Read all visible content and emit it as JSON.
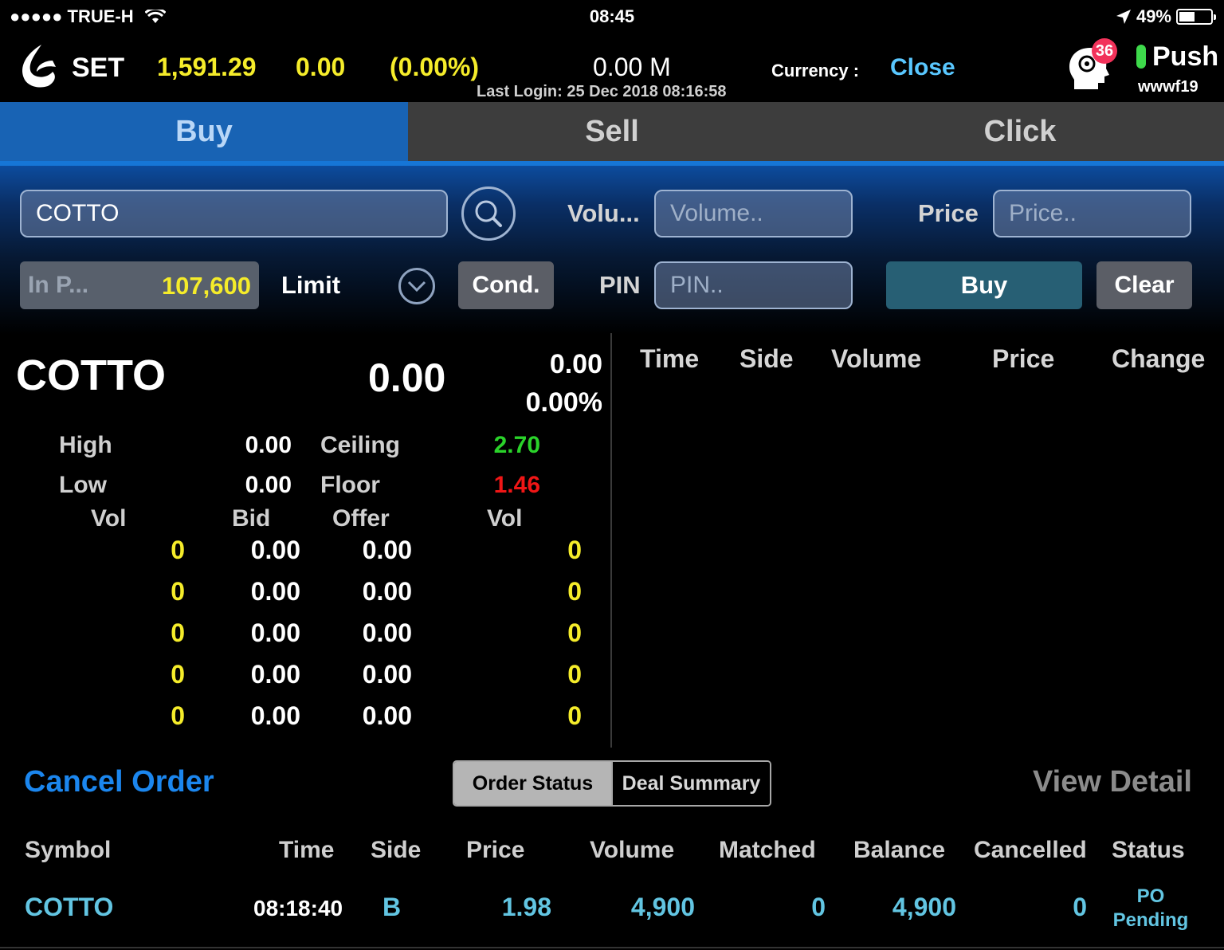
{
  "status_bar": {
    "carrier": "●●●●● TRUE-H",
    "time": "08:45",
    "battery": "49%",
    "battery_level": 0.49
  },
  "header": {
    "market": "SET",
    "index_value": "1,591.29",
    "index_change": "0.00",
    "index_change_pct": "(0.00%)",
    "value_traded": "0.00 M",
    "last_login": "Last Login: 25 Dec 2018 08:16:58",
    "currency_label": "Currency :",
    "currency_value": "Close",
    "notification_count": "36",
    "push_label": "Push",
    "username": "wwwf19"
  },
  "tabs": [
    {
      "label": "Buy",
      "active": true
    },
    {
      "label": "Sell",
      "active": false
    },
    {
      "label": "Click",
      "active": false
    }
  ],
  "order_form": {
    "symbol_value": "COTTO",
    "volume_label": "Volu...",
    "volume_placeholder": "Volume..",
    "price_label": "Price",
    "price_placeholder": "Price..",
    "inport_label": "In P...",
    "inport_value": "107,600",
    "order_type": "Limit",
    "cond_label": "Cond.",
    "pin_label": "PIN",
    "pin_placeholder": "PIN..",
    "buy_label": "Buy",
    "clear_label": "Clear"
  },
  "quote": {
    "symbol": "COTTO",
    "last": "0.00",
    "change": "0.00",
    "change_pct": "0.00%",
    "high_label": "High",
    "high": "0.00",
    "low_label": "Low",
    "low": "0.00",
    "ceiling_label": "Ceiling",
    "ceiling": "2.70",
    "floor_label": "Floor",
    "floor": "1.46",
    "depth_headers": [
      "Vol",
      "Bid",
      "Offer",
      "Vol"
    ],
    "depth": [
      {
        "bid_vol": "0",
        "bid": "0.00",
        "offer": "0.00",
        "offer_vol": "0"
      },
      {
        "bid_vol": "0",
        "bid": "0.00",
        "offer": "0.00",
        "offer_vol": "0"
      },
      {
        "bid_vol": "0",
        "bid": "0.00",
        "offer": "0.00",
        "offer_vol": "0"
      },
      {
        "bid_vol": "0",
        "bid": "0.00",
        "offer": "0.00",
        "offer_vol": "0"
      },
      {
        "bid_vol": "0",
        "bid": "0.00",
        "offer": "0.00",
        "offer_vol": "0"
      }
    ]
  },
  "ticker_headers": [
    "Time",
    "Side",
    "Volume",
    "Price",
    "Change"
  ],
  "orders": {
    "cancel_label": "Cancel Order",
    "segment": [
      "Order Status",
      "Deal Summary"
    ],
    "view_detail": "View Detail",
    "headers": [
      "Symbol",
      "Time",
      "Side",
      "Price",
      "Volume",
      "Matched",
      "Balance",
      "Cancelled",
      "Status"
    ],
    "rows": [
      {
        "symbol": "COTTO",
        "time": "08:18:40",
        "side": "B",
        "price": "1.98",
        "volume": "4,900",
        "matched": "0",
        "balance": "4,900",
        "cancelled": "0",
        "status_line1": "PO",
        "status_line2": "Pending"
      }
    ]
  },
  "colors": {
    "accent_blue": "#1863b4",
    "link_blue": "#1b86ee",
    "index_yellow": "#f5ec2a",
    "up_green": "#2ad32a",
    "down_red": "#f01616",
    "order_cyan": "#62c5e2"
  }
}
